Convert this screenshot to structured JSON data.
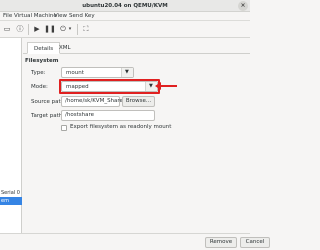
{
  "window": {
    "title": "ubuntu20.04 on QEMU/KVM"
  },
  "menu": {
    "items": [
      "File",
      "Virtual Machine",
      "View",
      "Send Key"
    ]
  },
  "sidebar": {
    "partial_labels": [
      "Serial 0",
      "em"
    ]
  },
  "tabs": [
    {
      "label": "Details",
      "active": true
    },
    {
      "label": "XML",
      "active": false
    }
  ],
  "filesystem": {
    "section_title": "Filesystem",
    "type_label": "Type:",
    "type_value": "mount",
    "mode_label": "Mode:",
    "mode_value": "mapped",
    "source_label": "Source path:",
    "source_value": "/home/sk/KVM_Share",
    "browse_label": "Browse...",
    "target_label": "Target path:",
    "target_value": "/hostshare",
    "readonly_label": "Export filesystem as readonly mount",
    "readonly_checked": false
  },
  "footer": {
    "remove_label": "Remove",
    "cancel_label": "Cancel"
  },
  "colors": {
    "highlight": "#e02020",
    "selection": "#3584e4"
  }
}
